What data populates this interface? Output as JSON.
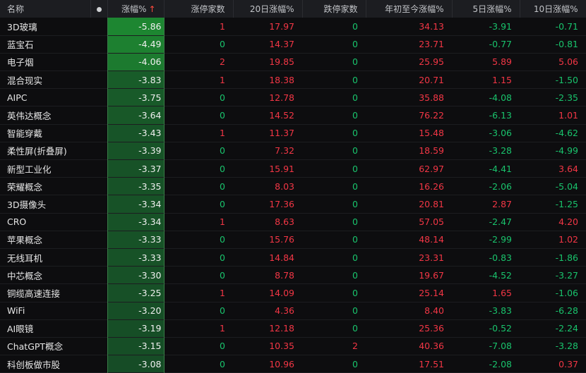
{
  "columns": {
    "name": "名称",
    "change": "涨幅%",
    "limit_up": "涨停家数",
    "chg20": "20日涨幅%",
    "limit_down": "跌停家数",
    "ytd": "年初至今涨幅%",
    "chg5": "5日涨幅%",
    "chg10": "10日涨幅%"
  },
  "sort_indicator": "↑",
  "colors": {
    "up": "#f23645",
    "down": "#19c36c"
  },
  "rows": [
    {
      "name": "3D玻璃",
      "change": "-5.86",
      "change_shade": 0.92,
      "limit_up": "1",
      "chg20": "17.97",
      "limit_down": "0",
      "ytd": "34.13",
      "chg5": "-3.91",
      "chg10": "-0.71"
    },
    {
      "name": "蓝宝石",
      "change": "-4.49",
      "change_shade": 0.85,
      "limit_up": "0",
      "chg20": "14.37",
      "limit_down": "0",
      "ytd": "23.71",
      "chg5": "-0.77",
      "chg10": "-0.81"
    },
    {
      "name": "电子烟",
      "change": "-4.06",
      "change_shade": 0.78,
      "limit_up": "2",
      "chg20": "19.85",
      "limit_down": "0",
      "ytd": "25.95",
      "chg5": "5.89",
      "chg10": "5.06"
    },
    {
      "name": "混合现实",
      "change": "-3.83",
      "change_shade": 0.4,
      "limit_up": "1",
      "chg20": "18.38",
      "limit_down": "0",
      "ytd": "20.71",
      "chg5": "1.15",
      "chg10": "-1.50"
    },
    {
      "name": "AIPC",
      "change": "-3.75",
      "change_shade": 0.38,
      "limit_up": "0",
      "chg20": "12.78",
      "limit_down": "0",
      "ytd": "35.88",
      "chg5": "-4.08",
      "chg10": "-2.35"
    },
    {
      "name": "英伟达概念",
      "change": "-3.64",
      "change_shade": 0.35,
      "limit_up": "0",
      "chg20": "14.52",
      "limit_down": "0",
      "ytd": "76.22",
      "chg5": "-6.13",
      "chg10": "1.01"
    },
    {
      "name": "智能穿戴",
      "change": "-3.43",
      "change_shade": 0.3,
      "limit_up": "1",
      "chg20": "11.37",
      "limit_down": "0",
      "ytd": "15.48",
      "chg5": "-3.06",
      "chg10": "-4.62"
    },
    {
      "name": "柔性屏(折叠屏)",
      "change": "-3.39",
      "change_shade": 0.29,
      "limit_up": "0",
      "chg20": "7.32",
      "limit_down": "0",
      "ytd": "18.59",
      "chg5": "-3.28",
      "chg10": "-4.99"
    },
    {
      "name": "新型工业化",
      "change": "-3.37",
      "change_shade": 0.28,
      "limit_up": "0",
      "chg20": "15.91",
      "limit_down": "0",
      "ytd": "62.97",
      "chg5": "-4.41",
      "chg10": "3.64"
    },
    {
      "name": "荣耀概念",
      "change": "-3.35",
      "change_shade": 0.28,
      "limit_up": "0",
      "chg20": "8.03",
      "limit_down": "0",
      "ytd": "16.26",
      "chg5": "-2.06",
      "chg10": "-5.04"
    },
    {
      "name": "3D摄像头",
      "change": "-3.34",
      "change_shade": 0.27,
      "limit_up": "0",
      "chg20": "17.36",
      "limit_down": "0",
      "ytd": "20.81",
      "chg5": "2.87",
      "chg10": "-1.25"
    },
    {
      "name": "CRO",
      "change": "-3.34",
      "change_shade": 0.27,
      "limit_up": "1",
      "chg20": "8.63",
      "limit_down": "0",
      "ytd": "57.05",
      "chg5": "-2.47",
      "chg10": "4.20"
    },
    {
      "name": "苹果概念",
      "change": "-3.33",
      "change_shade": 0.27,
      "limit_up": "0",
      "chg20": "15.76",
      "limit_down": "0",
      "ytd": "48.14",
      "chg5": "-2.99",
      "chg10": "1.02"
    },
    {
      "name": "无线耳机",
      "change": "-3.33",
      "change_shade": 0.27,
      "limit_up": "0",
      "chg20": "14.84",
      "limit_down": "0",
      "ytd": "23.31",
      "chg5": "-0.83",
      "chg10": "-1.86"
    },
    {
      "name": "中芯概念",
      "change": "-3.30",
      "change_shade": 0.26,
      "limit_up": "0",
      "chg20": "8.78",
      "limit_down": "0",
      "ytd": "19.67",
      "chg5": "-4.52",
      "chg10": "-3.27"
    },
    {
      "name": "铜缆高速连接",
      "change": "-3.25",
      "change_shade": 0.25,
      "limit_up": "1",
      "chg20": "14.09",
      "limit_down": "0",
      "ytd": "25.14",
      "chg5": "1.65",
      "chg10": "-1.06"
    },
    {
      "name": "WiFi",
      "change": "-3.20",
      "change_shade": 0.23,
      "limit_up": "0",
      "chg20": "4.36",
      "limit_down": "0",
      "ytd": "8.40",
      "chg5": "-3.83",
      "chg10": "-6.28"
    },
    {
      "name": "AI眼镜",
      "change": "-3.19",
      "change_shade": 0.23,
      "limit_up": "1",
      "chg20": "12.18",
      "limit_down": "0",
      "ytd": "25.36",
      "chg5": "-0.52",
      "chg10": "-2.24"
    },
    {
      "name": "ChatGPT概念",
      "change": "-3.15",
      "change_shade": 0.22,
      "limit_up": "0",
      "chg20": "10.35",
      "limit_down": "2",
      "ytd": "40.36",
      "chg5": "-7.08",
      "chg10": "-3.28"
    },
    {
      "name": "科创板做市股",
      "change": "-3.08",
      "change_shade": 0.2,
      "limit_up": "0",
      "chg20": "10.96",
      "limit_down": "0",
      "ytd": "17.51",
      "chg5": "-2.08",
      "chg10": "0.37"
    }
  ]
}
